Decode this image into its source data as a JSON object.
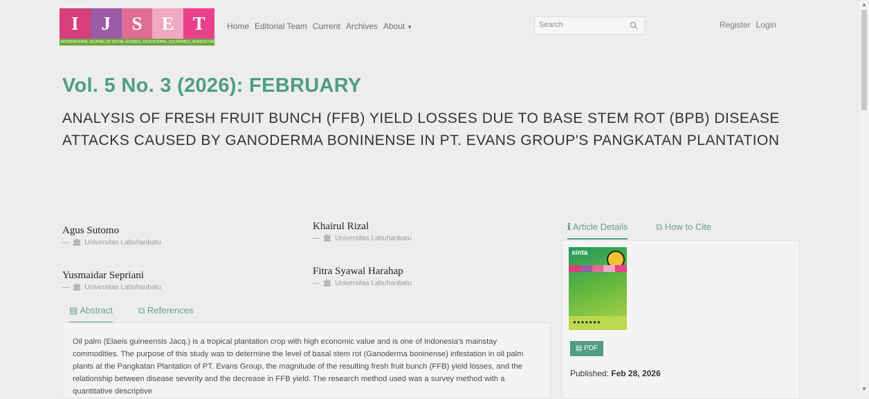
{
  "site": {
    "logo_letters": [
      "I",
      "J",
      "S",
      "E",
      "T"
    ],
    "logo_colors": [
      "#d53f7b",
      "#9b5ba5",
      "#e06d96",
      "#f1a8c3",
      "#e9418b"
    ],
    "logo_tagline": "INTERNATIONAL JOURNAL OF SOCIAL SCIENCE, EDUCATIONAL, ECONOMICS, AGRICULTURE RESEARCH, AND TECHNOLOGY"
  },
  "nav": {
    "items": [
      "Home",
      "Editorial Team",
      "Current",
      "Archives",
      "About"
    ],
    "about_has_dropdown": true
  },
  "search": {
    "placeholder": "Search",
    "icon": "search-icon"
  },
  "user_nav": {
    "register": "Register",
    "login": "Login"
  },
  "issue": {
    "title": "Vol. 5 No. 3 (2026): FEBRUARY"
  },
  "article": {
    "title": "ANALYSIS OF FRESH FRUIT BUNCH (FFB) YIELD LOSSES DUE TO BASE STEM ROT (BPB) DISEASE ATTACKS CAUSED BY GANODERMA BONINENSE IN PT. EVANS GROUP'S PANGKATAN PLANTATION"
  },
  "authors": [
    {
      "name": "Agus Sutomo",
      "affiliation": "Universitas Labuhanbatu"
    },
    {
      "name": "Khairul Rizal",
      "affiliation": "Universitas Labuhanbatu"
    },
    {
      "name": "Yusmaidar Sepriani",
      "affiliation": "Universitas Labuhanbatu"
    },
    {
      "name": "Fitra Syawal Harahap",
      "affiliation": "Universitas Labuhanbatu"
    }
  ],
  "left_tabs": {
    "abstract": "Abstract",
    "references": "References",
    "active": "abstract"
  },
  "abstract": {
    "text": "Oil palm (Elaeis guineensis Jacq.) is a tropical plantation crop with high economic value and is one of Indonesia's mainstay commodities. The purpose of this study was to determine the level of basal stem rot (Ganoderma boninense) infestation in oil palm plants at the Pangkatan Plantation of PT. Evans Group, the magnitude of the resulting fresh fruit bunch (FFB) yield losses, and the relationship between disease severity and the decrease in FFB yield. The research method used was a survey method with a quantitative descriptive"
  },
  "right_tabs": {
    "details": "Article Details",
    "cite": "How to Cite",
    "active": "details"
  },
  "sidebar": {
    "cover_badge": "sinta",
    "pdf_label": "PDF",
    "published_label": "Published:",
    "published_date": "Feb 28, 2026"
  },
  "accent_color": "#4f9d83"
}
